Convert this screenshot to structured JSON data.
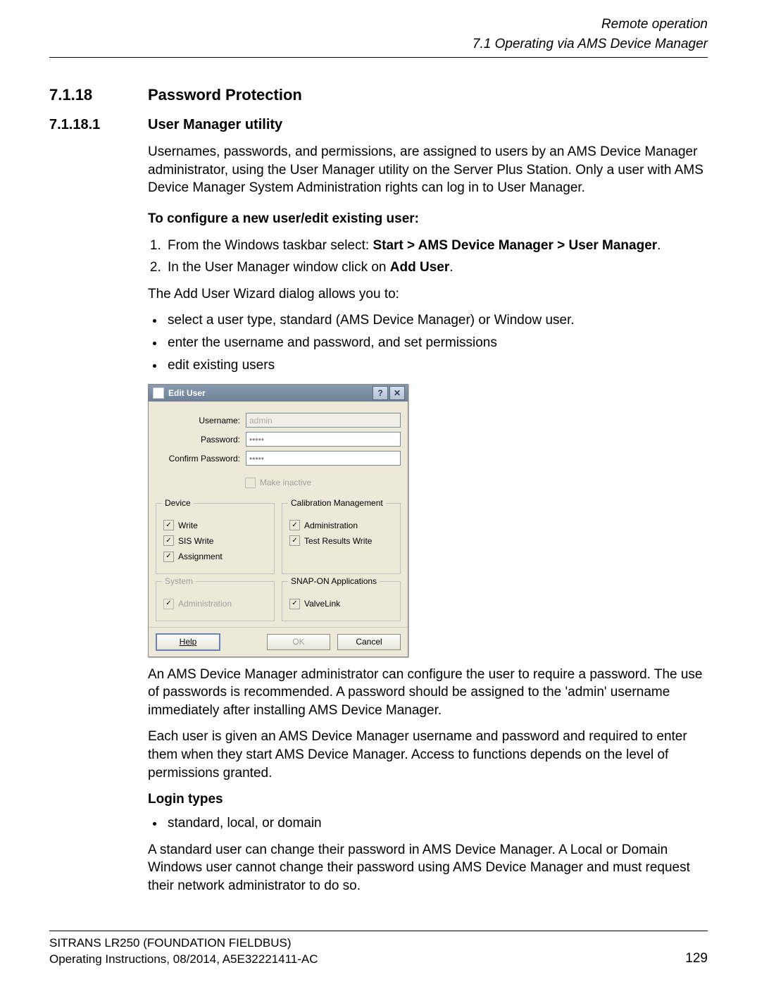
{
  "header": {
    "chapter_title": "Remote operation",
    "section_title": "7.1 Operating via AMS Device Manager"
  },
  "section": {
    "number": "7.1.18",
    "title": "Password Protection"
  },
  "subsection": {
    "number": "7.1.18.1",
    "title": "User Manager utility"
  },
  "paragraphs": {
    "intro": "Usernames, passwords, and permissions, are assigned to users by an AMS Device Manager administrator, using the User Manager utility on the Server Plus Station. Only a user with AMS Device Manager System Administration rights can log in to User Manager.",
    "configure_heading": "To configure a new user/edit existing user:",
    "steps": [
      {
        "pre": "From the Windows taskbar select: ",
        "bold": "Start > AMS Device Manager > User Manager",
        "post": "."
      },
      {
        "pre": "In the User Manager window click on ",
        "bold": "Add User",
        "post": "."
      }
    ],
    "allows_intro": "The Add User Wizard dialog allows you to:",
    "allows_bullets": [
      "select a user type, standard (AMS Device Manager) or Window user.",
      "enter the username and password, and set permissions",
      "edit existing users"
    ],
    "after_image_1": "An AMS Device Manager administrator can configure the user to require a password. The use of passwords is recommended. A password should be assigned to the 'admin' username immediately after installing AMS Device Manager.",
    "after_image_2": "Each user is given an AMS Device Manager username and password and required to enter them when they start AMS Device Manager. Access to functions depends on the level of permissions granted.",
    "login_heading": "Login types",
    "login_bullets": [
      "standard, local, or domain"
    ],
    "login_para": "A standard user can change their password in AMS Device Manager. A Local or Domain Windows user cannot change their password using AMS Device Manager and must request their network administrator to do so."
  },
  "dialog": {
    "title": "Edit User",
    "help_glyph": "?",
    "close_glyph": "✕",
    "labels": {
      "username": "Username:",
      "password": "Password:",
      "confirm": "Confirm Password:",
      "make_inactive": "Make inactive"
    },
    "values": {
      "username": "admin",
      "password": "•••••",
      "confirm": "•••••"
    },
    "groups": {
      "device": {
        "legend": "Device",
        "opts": [
          {
            "label": "Write",
            "checked": true
          },
          {
            "label": "SIS Write",
            "checked": true
          },
          {
            "label": "Assignment",
            "checked": true
          }
        ]
      },
      "calib": {
        "legend": "Calibration Management",
        "opts": [
          {
            "label": "Administration",
            "checked": true
          },
          {
            "label": "Test Results Write",
            "checked": true
          }
        ]
      },
      "system": {
        "legend": "System",
        "opts": [
          {
            "label": "Administration",
            "checked": true,
            "disabled": true
          }
        ]
      },
      "snap": {
        "legend": "SNAP-ON Applications",
        "opts": [
          {
            "label": "ValveLink",
            "checked": true
          }
        ]
      }
    },
    "buttons": {
      "help": "Help",
      "ok": "OK",
      "cancel": "Cancel"
    }
  },
  "footer": {
    "product": "SITRANS LR250 (FOUNDATION FIELDBUS)",
    "docinfo": "Operating Instructions, 08/2014, A5E32221411-AC",
    "page": "129"
  }
}
